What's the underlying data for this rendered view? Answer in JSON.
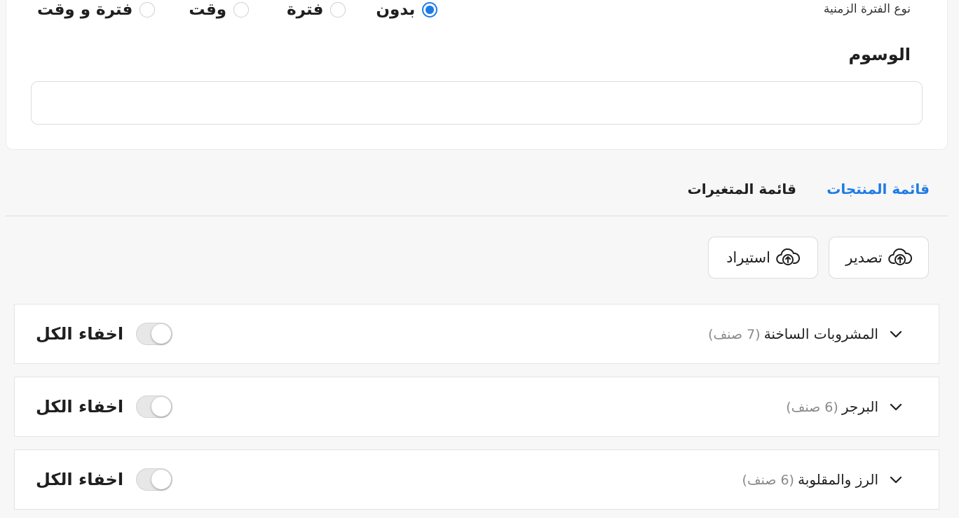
{
  "form": {
    "period_type_label": "نوع الفترة الزمنية",
    "period_options": [
      "بدون",
      "فترة",
      "وقت",
      "فترة و وقت"
    ],
    "period_selected": "بدون",
    "tags_label": "الوسوم",
    "tags_value": ""
  },
  "tabs": {
    "products": "قائمة المنتجات",
    "variants": "قائمة المتغيرات",
    "active": "products"
  },
  "actions": {
    "export_label": "تصدير",
    "import_label": "استيراد"
  },
  "categories": [
    {
      "name": "المشروبات الساخنة",
      "count": "(7 صنف)",
      "toggle_label": "اخفاء الكل",
      "hidden": false
    },
    {
      "name": "البرجر",
      "count": "(6 صنف)",
      "toggle_label": "اخفاء الكل",
      "hidden": false
    },
    {
      "name": "الرز والمقلوبة",
      "count": "(6 صنف)",
      "toggle_label": "اخفاء الكل",
      "hidden": false
    }
  ],
  "colors": {
    "accent": "#1e7be6",
    "border": "#dcdcdc",
    "background": "#f7f7f7"
  },
  "icons": {
    "upload": "cloud-upload-icon",
    "expand": "chevron-down-icon"
  }
}
